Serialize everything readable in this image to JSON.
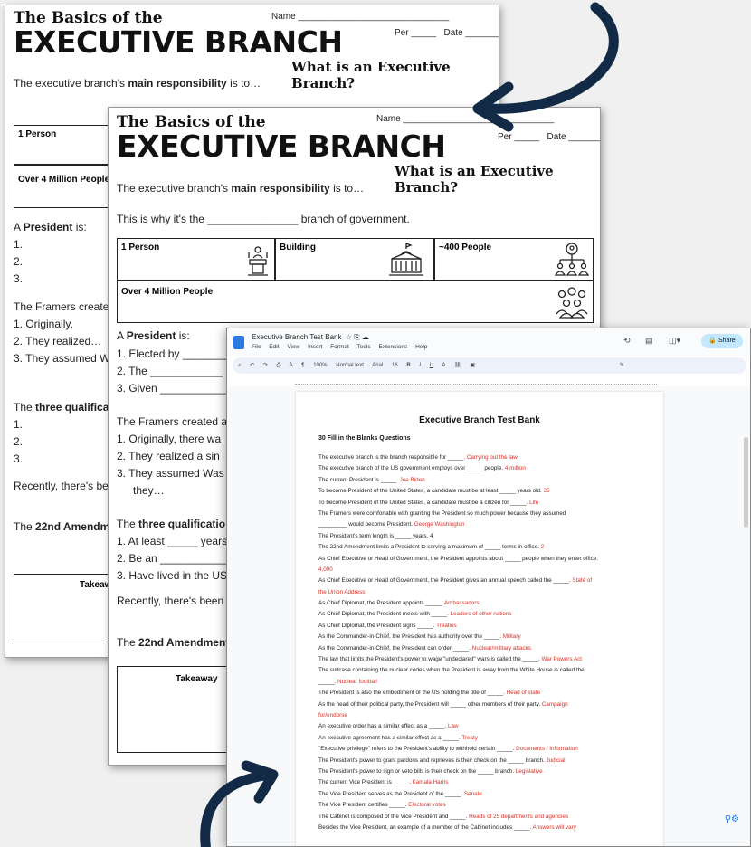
{
  "worksheet_back": {
    "title_small": "The Basics of the",
    "title_big": "EXECUTIVE BRANCH",
    "name_label": "Name",
    "per_label": "Per",
    "date_label": "Date",
    "question": "What is an Executive Branch?",
    "responsibility_prefix": "The executive branch's",
    "responsibility_bold": "main responsibility",
    "responsibility_suffix": "is to…",
    "boxes": [
      "1 Person",
      "Over 4 Million People"
    ],
    "president_prefix": "A",
    "president_bold": "President",
    "president_suffix": "is:",
    "list_numbers": [
      "1.",
      "2.",
      "3."
    ],
    "framers": "The Framers create",
    "framers_items": [
      "1.  Originally,",
      "2.  They realized…",
      "3.  They assumed W"
    ],
    "qual_prefix": "The",
    "qual_bold": "three qualifica",
    "qual_numbers": [
      "1.",
      "2.",
      "3."
    ],
    "recently": "Recently, there's be",
    "amend_prefix": "The",
    "amend_bold": "22nd Amendme",
    "takeaway": "Takeaw"
  },
  "worksheet_front": {
    "title_small": "The Basics of the",
    "title_big": "EXECUTIVE BRANCH",
    "name_label": "Name",
    "per_label": "Per",
    "date_label": "Date",
    "question": "What is an Executive Branch?",
    "responsibility_prefix": "The executive branch's",
    "responsibility_bold": "main responsibility",
    "responsibility_suffix": "is to…",
    "why_text": "This is why it's the _______________ branch of government.",
    "box_labels": {
      "person": "1 Person",
      "building": "Building",
      "people400": "~400 People",
      "million": "Over 4 Million People"
    },
    "president_prefix": "A",
    "president_bold": "President",
    "president_suffix": "is:",
    "president_items": [
      "1. Elected by",
      "2. The",
      "3. Given"
    ],
    "framers": "The Framers created a",
    "framers_items": [
      "1.  Originally, there wa",
      "2.  They realized a sin",
      "3.  They assumed Was",
      "they…"
    ],
    "qual_prefix": "The",
    "qual_bold": "three qualificatio",
    "qual_items": [
      "1. At least _____ years",
      "2. Be an ___________",
      "3. Have lived in the US"
    ],
    "recently": "Recently, there's been",
    "amend_prefix": "The",
    "amend_bold": "22nd Amendment",
    "takeaway": "Takeaway"
  },
  "gdoc": {
    "doc_name": "Executive Branch Test Bank",
    "menu": [
      "File",
      "Edit",
      "View",
      "Insert",
      "Format",
      "Tools",
      "Extensions",
      "Help"
    ],
    "share_label": "Share",
    "toolbar": {
      "zoom": "100%",
      "style": "Normal text",
      "font": "Arial",
      "size": "16"
    },
    "title": "Executive Branch Test Bank",
    "subtitle": "30 Fill in the Blanks Questions",
    "lines": [
      {
        "q": "The executive branch is the branch responsible for _____.",
        "a": "Carrying out the law"
      },
      {
        "q": "The executive branch of the US government employs over _____ people.",
        "a": "4 million"
      },
      {
        "q": "The current President is _____.",
        "a": "Joe Biden"
      },
      {
        "q": "To become President of the United States, a candidate must be at least _____ years old.",
        "a": "35"
      },
      {
        "q": "To become President of the United States, a candidate must be a citizen for _____.",
        "a": "Life"
      },
      {
        "q": "The Framers were comfortable with granting the President so much power because they assumed",
        "a": ""
      },
      {
        "q": "_________ would become President.",
        "a": "George Washington"
      },
      {
        "q": "The President's term length is _____ years. 4",
        "a": ""
      },
      {
        "q": "The 22nd Amendment limits a President to serving a maximum of _____ terms in office.",
        "a": "2"
      },
      {
        "q": "As Chief Executive or Head of Government, the President appoints about _____ people when they enter office.",
        "a": ""
      },
      {
        "q": "",
        "a": "4,000"
      },
      {
        "q": "As Chief Executive or  Head of Government, the President gives an annual speech called the _____.",
        "a": "State of"
      },
      {
        "q": "",
        "a": "the Union Address"
      },
      {
        "q": "As Chief Diplomat, the President appoints _____.",
        "a": "Ambassadors"
      },
      {
        "q": "As Chief Diplomat, the President meets with _____.",
        "a": "Leaders of other nations"
      },
      {
        "q": "As Chief Diplomat, the President signs _____.",
        "a": "Treaties"
      },
      {
        "q": "As the Commander-in-Chief, the President has authority over the _____.",
        "a": "Military"
      },
      {
        "q": "As the Commander-in-Chief, the President can order _____.",
        "a": "Nuclear/military attacks"
      },
      {
        "q": "The law that limits the President's power to wage \"undeclared\" wars is called the _____.",
        "a": "War Powers Act"
      },
      {
        "q": "The suitcase containing the nuclear codes when the President is away from the White House is called the",
        "a": ""
      },
      {
        "q": "_____.",
        "a": "Nuclear football"
      },
      {
        "q": "The President is also the embodiment of the US holding the title of _____.",
        "a": "Head of state"
      },
      {
        "q": "As the head of their political party, the President will _____ other members of their party.",
        "a": "Campaign"
      },
      {
        "q": "",
        "a": "for/endorse"
      },
      {
        "q": "An executive order has a similar effect as a _____.",
        "a": "Law"
      },
      {
        "q": "An executive agreement has a similar effect as a _____.",
        "a": "Treaty"
      },
      {
        "q": "\"Executive privilege\" refers to the President's ability to withhold certain _____.",
        "a": "Documents / Information"
      },
      {
        "q": "The President's power to grant pardons and reprieves is their check on the _____ branch.",
        "a": "Judicial"
      },
      {
        "q": "The President's power to sign or veto bills is their check on the _____ branch.",
        "a": "Legislative"
      },
      {
        "q": "The current Vice President is _____.",
        "a": "Kamala Harris"
      },
      {
        "q": "The Vice President serves as the President of the _____.",
        "a": "Senate"
      },
      {
        "q": "The Vice President certifies _____.",
        "a": "Electoral votes"
      },
      {
        "q": "The Cabinet is composed of the Vice President and _____.",
        "a": "Heads of 25 departments and agencies"
      },
      {
        "q": "Besides the Vice President, an example of a member of the Cabinet includes _____.",
        "a": "Answers will vary"
      }
    ]
  },
  "colors": {
    "arrow": "#132a46",
    "answer": "#d93025",
    "docs_blue": "#2a7ae4"
  }
}
